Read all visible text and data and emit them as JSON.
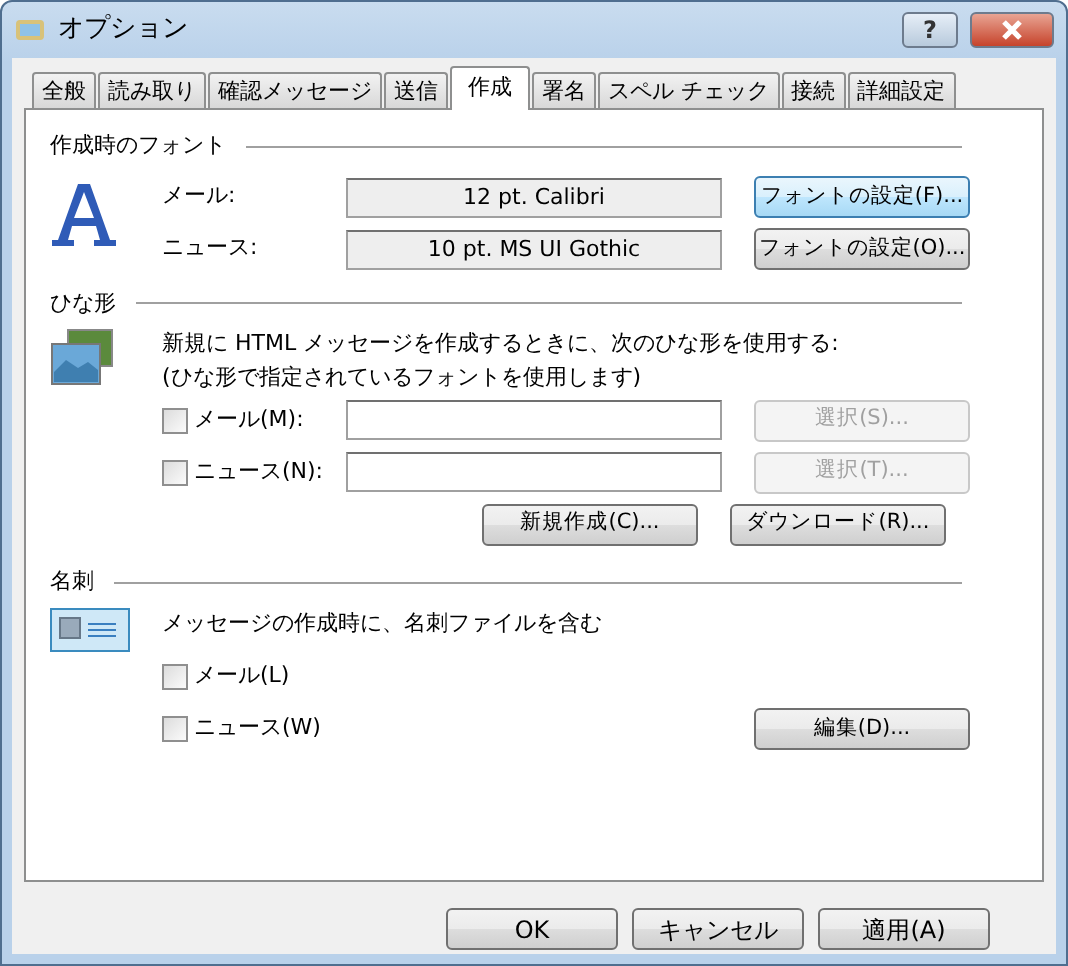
{
  "window": {
    "title": "オプション",
    "help_button": "?"
  },
  "tabs": [
    {
      "label": "全般",
      "selected": false
    },
    {
      "label": "読み取り",
      "selected": false
    },
    {
      "label": "確認メッセージ",
      "selected": false
    },
    {
      "label": "送信",
      "selected": false
    },
    {
      "label": "作成",
      "selected": true
    },
    {
      "label": "署名",
      "selected": false
    },
    {
      "label": "スペル チェック",
      "selected": false
    },
    {
      "label": "接続",
      "selected": false
    },
    {
      "label": "詳細設定",
      "selected": false
    }
  ],
  "compose_font": {
    "title": "作成時のフォント",
    "rows": [
      {
        "label": "メール:",
        "value": "12 pt. Calibri",
        "button": {
          "label": "フォントの設定(F)...",
          "focused": true
        }
      },
      {
        "label": "ニュース:",
        "value": "10 pt. MS UI Gothic",
        "button": {
          "label": "フォントの設定(O)...",
          "focused": false
        }
      }
    ]
  },
  "stationery": {
    "title": "ひな形",
    "description": [
      "新規に HTML メッセージを作成するときに、次のひな形を使用する:",
      "(ひな形で指定されているフォントを使用します)"
    ],
    "rows": [
      {
        "label": "メール(M):",
        "checked": false,
        "button": {
          "label": "選択(S)...",
          "disabled": true
        }
      },
      {
        "label": "ニュース(N):",
        "checked": false,
        "button": {
          "label": "選択(T)...",
          "disabled": true
        }
      }
    ],
    "buttons": [
      {
        "label": "新規作成(C)...",
        "disabled": false
      },
      {
        "label": "ダウンロード(R)...",
        "disabled": false
      }
    ]
  },
  "business_card": {
    "title": "名刺",
    "description": "メッセージの作成時に、名刺ファイルを含む",
    "rows": [
      {
        "label": "メール(L)",
        "checked": false
      },
      {
        "label": "ニュース(W)",
        "checked": false
      }
    ],
    "button": {
      "label": "編集(D)...",
      "disabled": false
    }
  },
  "footer_buttons": [
    "OK",
    "キャンセル",
    "適用(A)"
  ]
}
